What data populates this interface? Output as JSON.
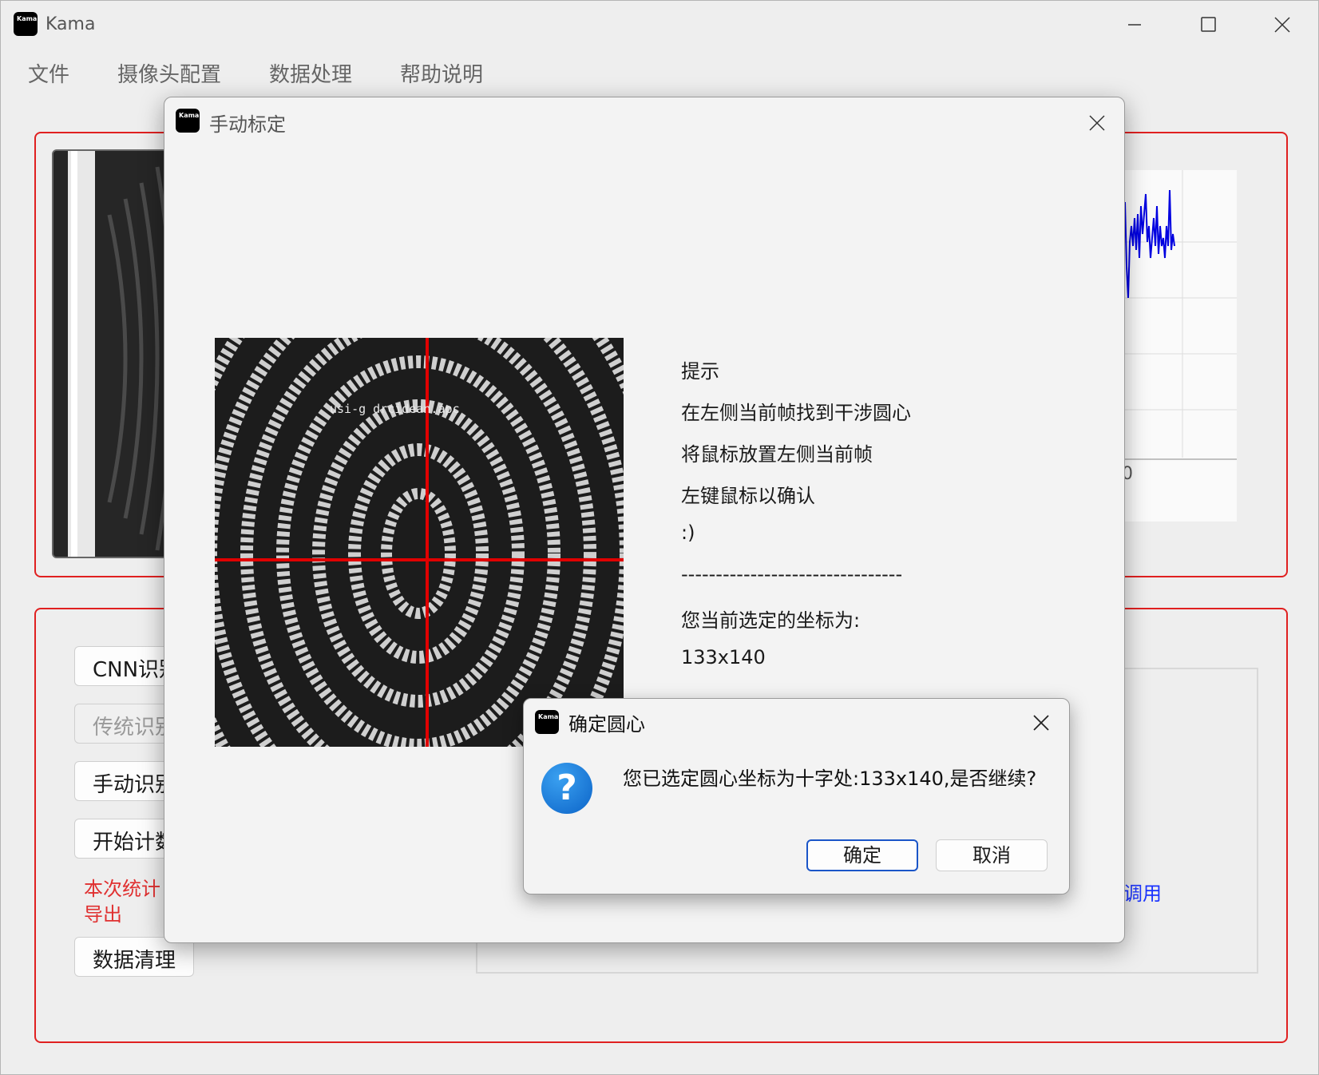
{
  "main_window": {
    "title": "Kama",
    "logo_text": "Kama",
    "menu": [
      "文件",
      "摄像头配置",
      "数据处理",
      "帮助说明"
    ],
    "buttons": {
      "cnn": "CNN识别",
      "traditional": "传统识别",
      "manual": "手动识别",
      "start_count": "开始计数",
      "data_clean": "数据清理"
    },
    "stats_note_line1": "本次统计",
    "stats_note_line2": "导出",
    "plot_tick": "0",
    "link_partial": "调用"
  },
  "calibration_dialog": {
    "title": "手动标定",
    "logo_text": "Kama",
    "frame_watermark": "usi-g drcidean.apc",
    "hints": [
      "提示",
      "在左侧当前帧找到干涉圆心",
      "将鼠标放置左侧当前帧",
      "左键鼠标以确认",
      ":)",
      "--------------------------------",
      "您当前选定的坐标为:",
      "133x140"
    ]
  },
  "confirm_dialog": {
    "title": "确定圆心",
    "logo_text": "Kama",
    "message": "您已选定圆心坐标为十字处:133x140,是否继续?",
    "ok": "确定",
    "cancel": "取消"
  },
  "colors": {
    "panel_border": "#e02020",
    "crosshair": "#e00000",
    "plot_line": "#0000e0",
    "link": "#1a33ff",
    "primary_border": "#1a55c8"
  },
  "icons": [
    "minimize-icon",
    "maximize-icon",
    "close-icon",
    "question-icon"
  ]
}
